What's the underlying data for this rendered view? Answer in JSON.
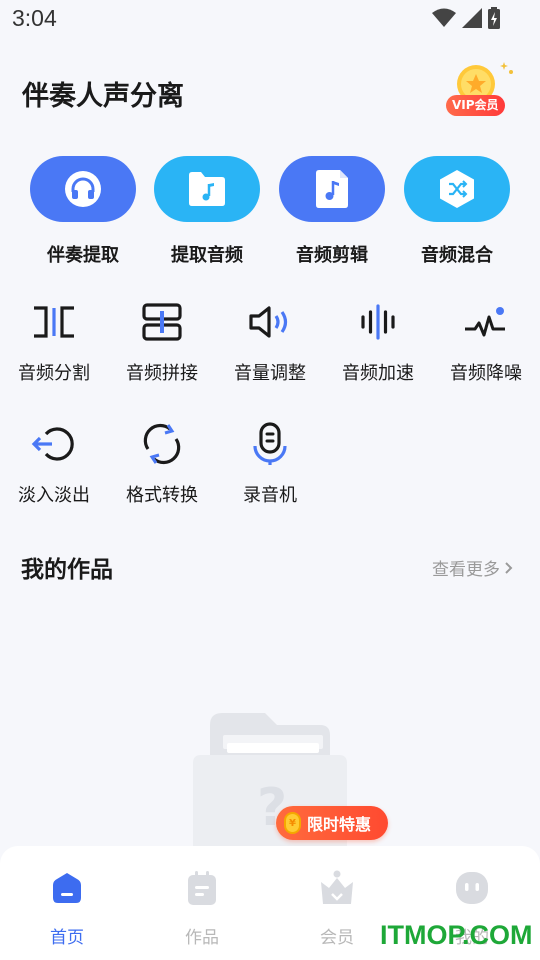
{
  "status_bar": {
    "time": "3:04"
  },
  "header": {
    "title": "伴奏人声分离",
    "vip_label": "VIP会员"
  },
  "big_tools": [
    {
      "label": "伴奏提取",
      "icon": "headphones-icon",
      "color": "#4a78f5"
    },
    {
      "label": "提取音频",
      "icon": "music-folder-icon",
      "color": "#2ab4f5"
    },
    {
      "label": "音频剪辑",
      "icon": "music-file-icon",
      "color": "#4a78f5"
    },
    {
      "label": "音频混合",
      "icon": "shuffle-icon",
      "color": "#2ab4f5"
    }
  ],
  "tools_row1": [
    {
      "label": "音频分割",
      "icon": "split-icon"
    },
    {
      "label": "音频拼接",
      "icon": "join-icon"
    },
    {
      "label": "音量调整",
      "icon": "volume-icon"
    },
    {
      "label": "音频加速",
      "icon": "waveform-icon"
    },
    {
      "label": "音频降噪",
      "icon": "noise-reduce-icon"
    }
  ],
  "tools_row2": [
    {
      "label": "淡入淡出",
      "icon": "fade-icon"
    },
    {
      "label": "格式转换",
      "icon": "convert-icon"
    },
    {
      "label": "录音机",
      "icon": "microphone-icon"
    }
  ],
  "works": {
    "title": "我的作品",
    "see_more": "查看更多"
  },
  "promo": {
    "label": "限时特惠"
  },
  "bottom_nav": [
    {
      "label": "首页",
      "icon": "home-icon",
      "active": true
    },
    {
      "label": "作品",
      "icon": "works-icon",
      "active": false
    },
    {
      "label": "会员",
      "icon": "crown-icon",
      "active": false
    },
    {
      "label": "我的",
      "icon": "profile-icon",
      "active": false
    }
  ],
  "watermark": "ITMOP.COM",
  "colors": {
    "accent": "#3d6cf0",
    "blue": "#4a78f5",
    "cyan": "#2ab4f5",
    "promo": "#ff5a35"
  }
}
